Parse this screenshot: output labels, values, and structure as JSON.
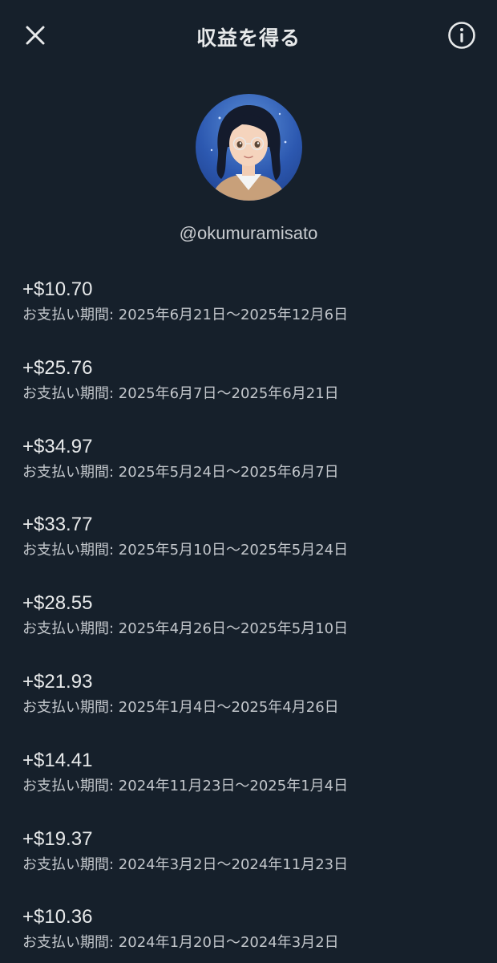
{
  "header": {
    "title": "収益を得る",
    "close_icon": "close-icon",
    "info_icon": "info-icon"
  },
  "profile": {
    "handle": "@okumuramisato",
    "avatar": "illustrated-avatar"
  },
  "payouts": [
    {
      "amount": "+$10.70",
      "period": "お支払い期間: 2025年6月21日〜2025年12月6日"
    },
    {
      "amount": "+$25.76",
      "period": "お支払い期間: 2025年6月7日〜2025年6月21日"
    },
    {
      "amount": "+$34.97",
      "period": "お支払い期間: 2025年5月24日〜2025年6月7日"
    },
    {
      "amount": "+$33.77",
      "period": "お支払い期間: 2025年5月10日〜2025年5月24日"
    },
    {
      "amount": "+$28.55",
      "period": "お支払い期間: 2025年4月26日〜2025年5月10日"
    },
    {
      "amount": "+$21.93",
      "period": "お支払い期間: 2025年1月4日〜2025年4月26日"
    },
    {
      "amount": "+$14.41",
      "period": "お支払い期間: 2024年11月23日〜2025年1月4日"
    },
    {
      "amount": "+$19.37",
      "period": "お支払い期間: 2024年3月2日〜2024年11月23日"
    },
    {
      "amount": "+$10.36",
      "period": "お支払い期間: 2024年1月20日〜2024年3月2日"
    }
  ],
  "colors": {
    "background": "#16202b",
    "text_primary": "#e7e9ea",
    "text_secondary": "#c2c6cb"
  }
}
